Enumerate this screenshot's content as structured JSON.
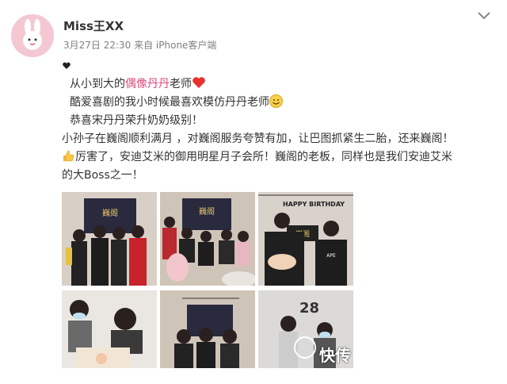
{
  "post": {
    "author": "Miss王XX",
    "meta": "3月27日 22:30 来自 iPhone客户端"
  },
  "content": {
    "line1_pre": "从小到大的",
    "line1_pink": "偶像丹丹",
    "line1_post": "老师",
    "line2": "酷爱喜剧的我小时候最喜欢模仿丹丹老师",
    "line3": "恭喜宋丹丹荣升奶奶级别！",
    "line4": "小孙子在巍阁顺利满月 ，对巍阁服务夸赞有加，让巴图抓紧生二胎，还来巍阁！",
    "line5": "厉害了，安迪艾米的御用明星月子会所！巍阁的老板，同样也是我们安迪艾米",
    "line6": "的大Boss之一！"
  },
  "photos": {
    "p1_sign": "巍阁",
    "p2_sign": "巍阁",
    "p3_sign": "巍阁",
    "p3_banner": "HAPPY BIRTHDAY",
    "p8_number": "28"
  },
  "watermark": "快传",
  "icons": {
    "avatar": "bunny-avatar",
    "chevron": "chevron-down-icon",
    "heart": "red-heart-icon",
    "smile": "smile-emoji-icon",
    "thumb": "thumbs-up-emoji-icon"
  },
  "colors": {
    "accent_pink": "#e04a78",
    "meta_gray": "#808080"
  }
}
